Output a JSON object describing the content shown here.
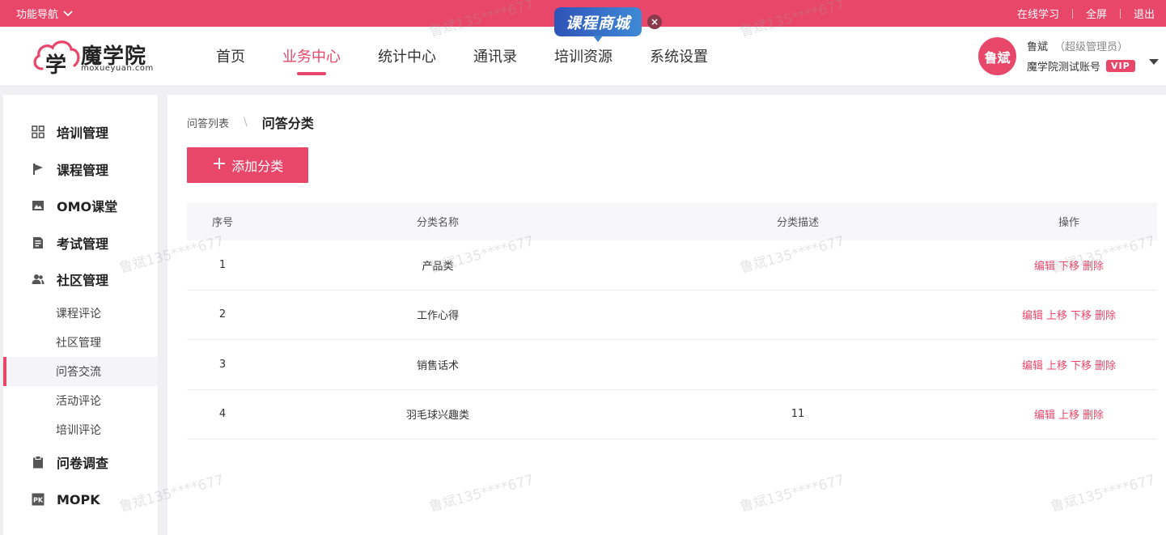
{
  "topbar": {
    "func_nav": "功能导航",
    "links": [
      "在线学习",
      "全屏",
      "退出"
    ]
  },
  "logo": {
    "name": "魔学院",
    "sub": "moxueyuan.com",
    "glyph": "学"
  },
  "nav": {
    "items": [
      "首页",
      "业务中心",
      "统计中心",
      "通讯录",
      "培训资源",
      "系统设置"
    ],
    "active_index": 1
  },
  "promo": {
    "label": "课程商城",
    "close": "×"
  },
  "user": {
    "avatar_text": "鲁斌",
    "name": "鲁斌",
    "role": "（超级管理员）",
    "account": "魔学院测试账号",
    "vip": "VIP"
  },
  "sidebar": {
    "groups": [
      {
        "label": "培训管理",
        "icon": "grid-icon"
      },
      {
        "label": "课程管理",
        "icon": "flag-icon"
      },
      {
        "label": "OMO课堂",
        "icon": "image-icon"
      },
      {
        "label": "考试管理",
        "icon": "document-icon"
      },
      {
        "label": "社区管理",
        "icon": "users-icon"
      },
      {
        "label": "问卷调查",
        "icon": "clipboard-icon"
      },
      {
        "label": "MOPK",
        "icon": "pk-icon"
      }
    ],
    "community_subs": [
      "课程评论",
      "社区管理",
      "问答交流",
      "活动评论",
      "培训评论"
    ],
    "active_sub": "问答交流",
    "pk_icon_text": "PK"
  },
  "main": {
    "breadcrumb": {
      "parent": "问答列表",
      "sep": "\\",
      "current": "问答分类"
    },
    "add_button": {
      "plus": "+",
      "label": "添加分类"
    },
    "table": {
      "headers": [
        "序号",
        "分类名称",
        "分类描述",
        "操作"
      ],
      "rows": [
        {
          "index": "1",
          "name": "产品类",
          "desc": "",
          "ops": [
            "编辑",
            "下移",
            "删除"
          ]
        },
        {
          "index": "2",
          "name": "工作心得",
          "desc": "",
          "ops": [
            "编辑",
            "上移",
            "下移",
            "删除"
          ]
        },
        {
          "index": "3",
          "name": "销售话术",
          "desc": "",
          "ops": [
            "编辑",
            "上移",
            "下移",
            "删除"
          ]
        },
        {
          "index": "4",
          "name": "羽毛球兴趣类",
          "desc": "11",
          "ops": [
            "编辑",
            "上移",
            "删除"
          ]
        }
      ]
    }
  },
  "watermark": "鲁斌135****677",
  "colors": {
    "accent": "#e8476a",
    "promo_blue": "#2f53b8"
  }
}
